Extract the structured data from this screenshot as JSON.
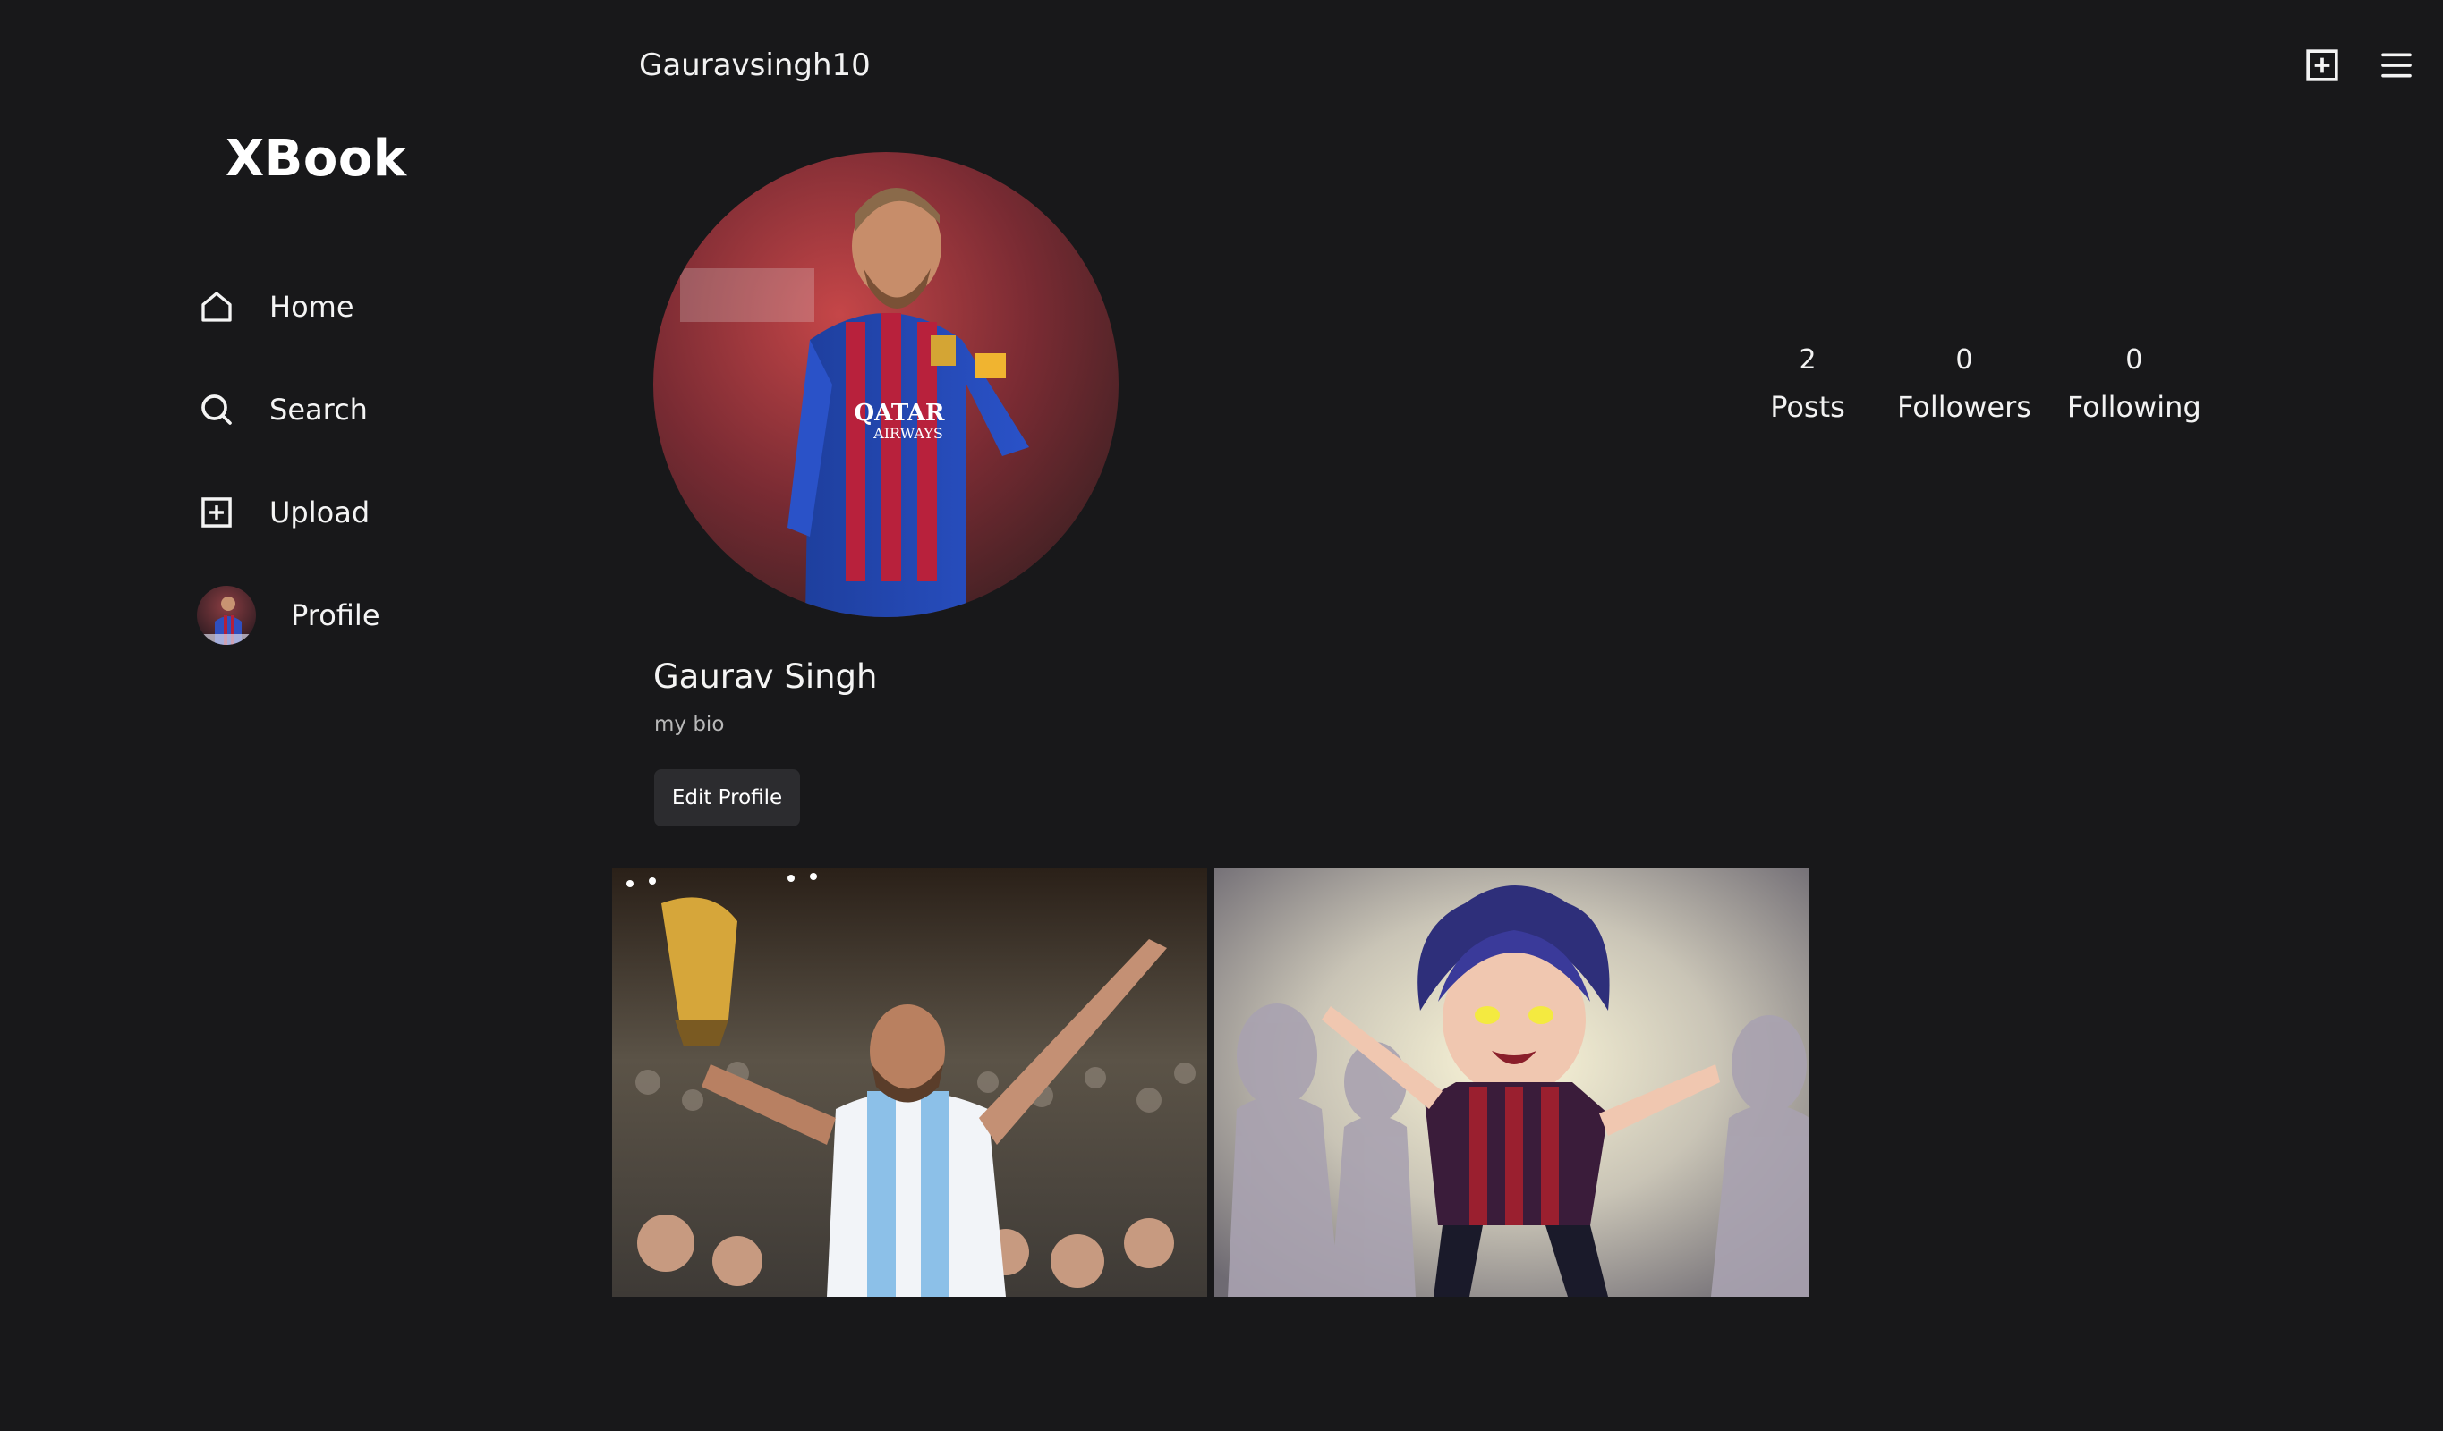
{
  "sidebar": {
    "brand": "XBook",
    "items": [
      {
        "label": "Home",
        "icon": "home-icon"
      },
      {
        "label": "Search",
        "icon": "search-icon"
      },
      {
        "label": "Upload",
        "icon": "plus-square-icon"
      },
      {
        "label": "Profile",
        "icon": "avatar"
      }
    ]
  },
  "header": {
    "username": "Gauravsingh10",
    "icons": [
      "plus-square-icon",
      "menu-icon"
    ]
  },
  "profile": {
    "name": "Gaurav Singh",
    "bio": "my bio",
    "edit_label": "Edit Profile",
    "stats": [
      {
        "count": "2",
        "label": "Posts"
      },
      {
        "count": "0",
        "label": "Followers"
      },
      {
        "count": "0",
        "label": "Following"
      }
    ]
  },
  "colors": {
    "background": "#18181a",
    "button": "#2c2c2f",
    "text": "#f2f2f2",
    "muted": "#b8b8b8"
  }
}
